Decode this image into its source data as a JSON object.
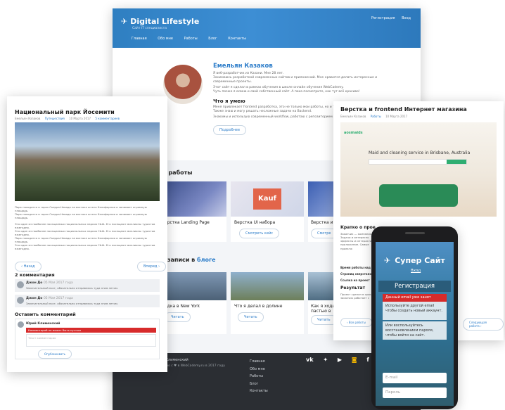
{
  "main": {
    "brand": "Digital Lifestyle",
    "tagline": "Сайт IT специалиста",
    "nav": [
      "Главная",
      "Обо мне",
      "Работы",
      "Блог",
      "Контакты"
    ],
    "register": "Регистрация",
    "login": "Вход",
    "profile_name": "Емельян Казаков",
    "profile_text1": "Я веб-разработчик из Казани. Мне 28 лет.",
    "profile_text2": "Занимаюсь разработкой современных сайтов и приложений. Мне нравится делать интересные и современные проекты.",
    "profile_text3": "Этот сайт я сделал в рамках обучения в школе онлайн обучения WebCademy.",
    "profile_text4": "Чуть позже я освою и свой собственный сайт. А пока посмотрите, как тут всё красиво!",
    "skills_title": "Что я умею",
    "skills_text": "Меня привлекает frontend разработка, это не только мои работы, но и тайны.",
    "skills_text2": "Также знаю и могу решать несложные задачи на Backend.",
    "skills_text3": "Знакомы и использую современный workflow, работаю с репозиторием git и github.",
    "details_btn": "Подробнее",
    "works_title": "ые работы",
    "works": [
      {
        "title": "ерстка Landing Page",
        "btn": ""
      },
      {
        "title": "Верстка UI набора",
        "btn": "Смотреть кейс"
      },
      {
        "title": "Верстка ин",
        "btn": "Смотре"
      }
    ],
    "kauf_label": "Kauf",
    "posts_title": "ие записи в",
    "posts_title_link": "блоге",
    "posts": [
      {
        "title": "одка в New York",
        "btn": "Читать"
      },
      {
        "title": "Что я делал в долине",
        "btn": "Читать"
      },
      {
        "title": "Как я ходил",
        "title2": "пастью в",
        "btn": "Читать"
      }
    ],
    "footer_author": "Н Клименский",
    "footer_copy": "Создано с ♥ в WebCademy.ru в 2017 году",
    "footer_links": [
      "Главная",
      "Обо мне",
      "Работы",
      "Блог",
      "Контакты"
    ],
    "social_icons": [
      "vk-icon",
      "twitter-icon",
      "youtube-icon",
      "instagram-icon",
      "facebook-icon"
    ]
  },
  "blog": {
    "title": "Национальный парк Йосемити",
    "meta": [
      "Емельян Казаков",
      "Путешествия",
      "10 Марта 2017",
      "5 комментариев"
    ],
    "text1": "Парк находится в горах Сьерра-Невада на востоке штата Калифорния и занимает огромную площадь.",
    "text2": "Это один из наиболее посещаемых национальных парков США. Его посещают миллионы туристов ежегодно.",
    "back": "‹ Назад",
    "forward": "Вперед ›",
    "comments_title": "2 комментария",
    "comments": [
      {
        "author": "Джон До",
        "date": "05 Мая 2017 года",
        "text": "Замечательный пост, обязательно отправлюсь туда этим летом."
      },
      {
        "author": "Джон До",
        "date": "05 Мая 2017 года",
        "text": "Замечательный пост, обязательно отправлюсь туда этим летом."
      }
    ],
    "leave_comment": "Оставить комментарий",
    "commenter": "Юрий Клименский",
    "error": "Комментарий не может быть пустым",
    "placeholder": "Текст комментария",
    "submit": "Опубликовать"
  },
  "right": {
    "title": "Верстка и frontend Интернет магазина",
    "meta": [
      "Емельян Казаков",
      "Работы",
      "10 Марта 2017"
    ],
    "site_logo": "aosmaids",
    "site_hero": "Maid and cleaning service in Brisbane, Australia",
    "brief": "Кратко о прое",
    "brief_lines": [
      "Заказчик — компания",
      "Задачи и интересно",
      "эффекты и интерактив",
      "приложение. Самые",
      "проекта:"
    ],
    "time_label": "Время работы над",
    "pages_label": "Страниц сверстано",
    "link_label": "Ссылка на проект",
    "result_label": "Результат",
    "result_lines": [
      "Проект сделан в сроки",
      "заказчик работает с"
    ],
    "all_works": "‹ Все работы",
    "next_work": "Следующая работа ›"
  },
  "phone": {
    "brand": "Супер Сайт",
    "login": "Вход",
    "reg_title": "Регистрация",
    "error": "Данный email уже занят",
    "hint1": "Используйте другой email чтобы создать новый аккаунт.",
    "hint2": "Или воспользуйтесь восстановлением пароля, чтобы войти на сайт.",
    "email_ph": "E-mail",
    "pass_ph": "Пароль"
  }
}
